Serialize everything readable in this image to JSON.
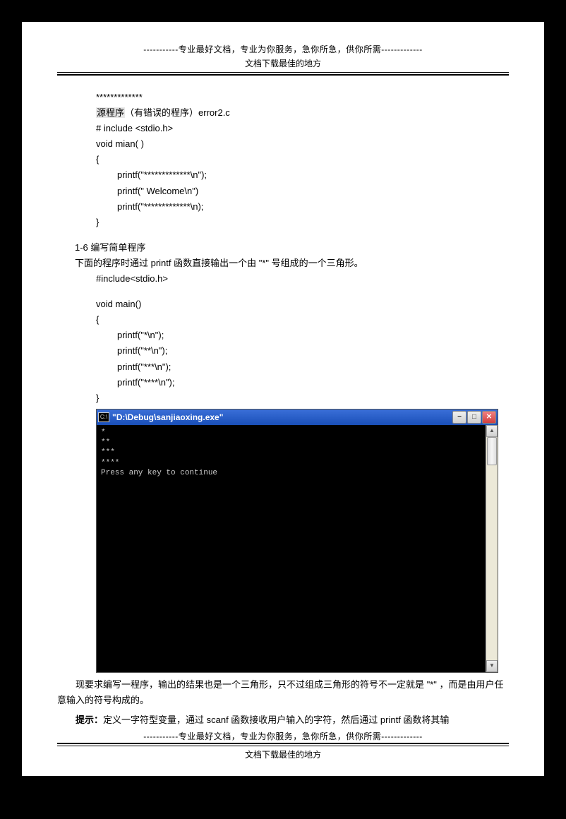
{
  "header": {
    "banner": "-----------专业最好文档，专业为你服务，急你所急，供你所需-------------",
    "subtitle": "文档下载最佳的地方"
  },
  "code1": {
    "stars": "*************",
    "label_hl": "源程序",
    "label_rest": "（有错误的程序）error2.c",
    "l1": "# include <stdio.h>",
    "l2": "void mian( )",
    "l3": "{",
    "l4": "printf(\"*************\\n\");",
    "l5": "printf(\"    Welcome\\n\")",
    "l6": "printf(\"*************\\n);",
    "l7": "}"
  },
  "section": {
    "num": "1-6  编写简单程序",
    "desc": "下面的程序时通过 printf 函数直接输出一个由 \"*\" 号组成的一个三角形。"
  },
  "code2": {
    "l1": "#include<stdio.h>",
    "l2": "void main()",
    "l3": "{",
    "l4": "printf(\"*\\n\");",
    "l5": "printf(\"**\\n\");",
    "l6": "printf(\"***\\n\");",
    "l7": "printf(\"****\\n\");",
    "l8": "}"
  },
  "cmd": {
    "title": "\"D:\\Debug\\sanjiaoxing.exe\"",
    "icon_label": "C:\\",
    "output": "*\n**\n***\n****\nPress any key to continue"
  },
  "bottom": {
    "p1": "现要求编写一程序，输出的结果也是一个三角形，只不过组成三角形的符号不一定就是 \"*\" ，而是由用户任意输入的符号构成的。",
    "hint_label": "提示：",
    "hint_text": "定义一字符型变量，通过 scanf 函数接收用户输入的字符，然后通过 printf 函数将其输"
  }
}
